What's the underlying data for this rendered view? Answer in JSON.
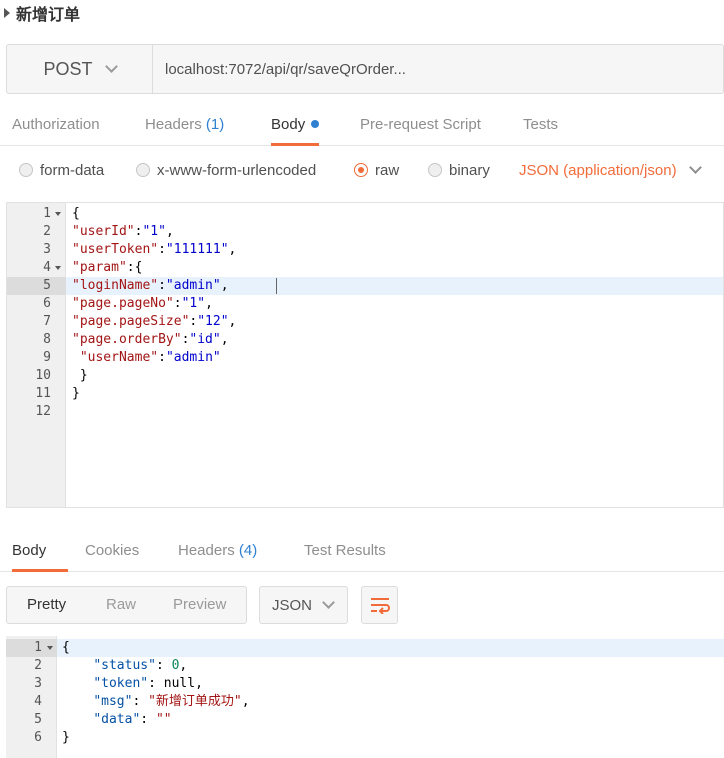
{
  "request": {
    "title": "新增订单",
    "method": "POST",
    "url": "localhost:7072/api/qr/saveQrOrder..."
  },
  "request_tabs": [
    {
      "label": "Authorization"
    },
    {
      "label": "Headers",
      "count": "(1)"
    },
    {
      "label": "Body",
      "active": true
    },
    {
      "label": "Pre-request Script"
    },
    {
      "label": "Tests"
    }
  ],
  "body_types": [
    {
      "label": "form-data",
      "checked": false
    },
    {
      "label": "x-www-form-urlencoded",
      "checked": false
    },
    {
      "label": "raw",
      "checked": true
    },
    {
      "label": "binary",
      "checked": false
    }
  ],
  "content_type": "JSON (application/json)",
  "request_body": {
    "line_numbers": [
      "1",
      "2",
      "3",
      "4",
      "5",
      "6",
      "7",
      "8",
      "9",
      "10",
      "11",
      "12"
    ],
    "lines": [
      "{",
      "\"userId\":\"1\",",
      "\"userToken\":\"111111\",",
      "\"param\":{",
      "\"loginName\":\"admin\",",
      "\"page.pageNo\":\"1\",",
      "\"page.pageSize\":\"12\",",
      "\"page.orderBy\":\"id\",",
      " \"userName\":\"admin\"",
      " }",
      "}",
      ""
    ]
  },
  "response_tabs": [
    {
      "label": "Body",
      "active": true
    },
    {
      "label": "Cookies"
    },
    {
      "label": "Headers",
      "count": "(4)"
    },
    {
      "label": "Test Results"
    }
  ],
  "response_toolbar": {
    "views": [
      "Pretty",
      "Raw",
      "Preview"
    ],
    "active_view": "Pretty",
    "format": "JSON"
  },
  "response_body": {
    "line_numbers": [
      "1",
      "2",
      "3",
      "4",
      "5",
      "6"
    ],
    "lines": [
      "{",
      "    \"status\": 0,",
      "    \"token\": null,",
      "    \"msg\": \"新增订单成功\",",
      "    \"data\": \"\"",
      "}"
    ]
  },
  "colors": {
    "accent": "#f26b3a",
    "count_blue": "#2f80d1"
  }
}
